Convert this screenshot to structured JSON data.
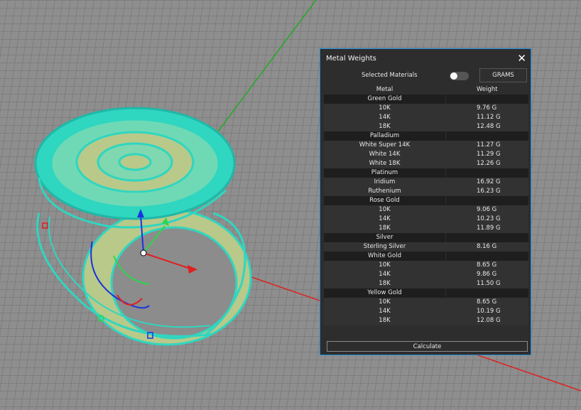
{
  "panel": {
    "title": "Metal Weights",
    "close_glyph": "✕",
    "selected_materials_label": "Selected Materials",
    "selected_materials_on": false,
    "units_label": "GRAMS",
    "headers": {
      "metal": "Metal",
      "weight": "Weight"
    },
    "calculate_label": "Calculate"
  },
  "groups": [
    {
      "name": "Green Gold",
      "items": [
        {
          "metal": "10K",
          "weight": "9.76 G"
        },
        {
          "metal": "14K",
          "weight": "11.12 G"
        },
        {
          "metal": "18K",
          "weight": "12.48 G"
        }
      ]
    },
    {
      "name": "Palladium",
      "items": [
        {
          "metal": "White Super 14K",
          "weight": "11.27 G"
        },
        {
          "metal": "White 14K",
          "weight": "11.29 G"
        },
        {
          "metal": "White 18K",
          "weight": "12.26 G"
        }
      ]
    },
    {
      "name": "Platinum",
      "items": [
        {
          "metal": "Iridium",
          "weight": "16.92 G"
        },
        {
          "metal": "Ruthenium",
          "weight": "16.23 G"
        }
      ]
    },
    {
      "name": "Rose Gold",
      "items": [
        {
          "metal": "10K",
          "weight": "9.06 G"
        },
        {
          "metal": "14K",
          "weight": "10.23 G"
        },
        {
          "metal": "18K",
          "weight": "11.89 G"
        }
      ]
    },
    {
      "name": "Silver",
      "items": [
        {
          "metal": "Sterling Silver",
          "weight": "8.16 G"
        }
      ]
    },
    {
      "name": "White Gold",
      "items": [
        {
          "metal": "10K",
          "weight": "8.65 G"
        },
        {
          "metal": "14K",
          "weight": "9.86 G"
        },
        {
          "metal": "18K",
          "weight": "11.50 G"
        }
      ]
    },
    {
      "name": "Yellow Gold",
      "items": [
        {
          "metal": "10K",
          "weight": "8.65 G"
        },
        {
          "metal": "14K",
          "weight": "10.19 G"
        },
        {
          "metal": "18K",
          "weight": "12.08 G"
        }
      ]
    }
  ],
  "colors": {
    "panel_bg": "#2d2d2d",
    "panel_border": "#1e8ad6",
    "ring_wireframe": "#2fd6c0",
    "ring_body": "#b8c98a",
    "axis_x": "#e02020",
    "axis_y": "#22aa22",
    "gumball_z": "#1a33e0"
  }
}
